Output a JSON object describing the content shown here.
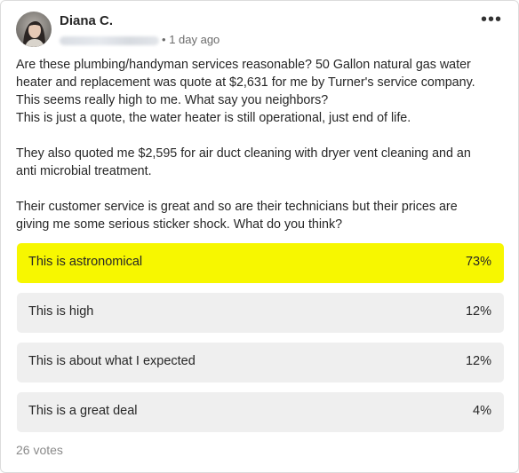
{
  "post": {
    "author": "Diana C.",
    "time": "1 day ago",
    "separator": "•",
    "more_label": "•••",
    "body": [
      [
        "Are these plumbing/handyman services reasonable? 50 Gallon natural gas water",
        "heater and replacement was quote at $2,631 for me by Turner's service company.",
        "This seems really high to me. What say you neighbors?",
        "This is just a quote, the water heater is still operational, just end of life."
      ],
      [
        "They also quoted me $2,595 for air duct cleaning with dryer vent cleaning and an",
        "anti microbial treatment."
      ],
      [
        "Their customer service is great and so are their technicians but their prices are",
        "giving me some serious sticker shock. What do you think?"
      ]
    ]
  },
  "poll": {
    "options": [
      {
        "label": "This is astronomical",
        "percent_text": "73%",
        "fill_fraction": 1.0
      },
      {
        "label": "This is high",
        "percent_text": "12%",
        "fill_fraction": 0
      },
      {
        "label": "This is about what I expected",
        "percent_text": "12%",
        "fill_fraction": 0
      },
      {
        "label": "This is a great deal",
        "percent_text": "4%",
        "fill_fraction": 0
      }
    ],
    "votes_text": "26 votes",
    "colors": {
      "highlight": "#f7f700",
      "option_bg": "#efefef"
    }
  }
}
